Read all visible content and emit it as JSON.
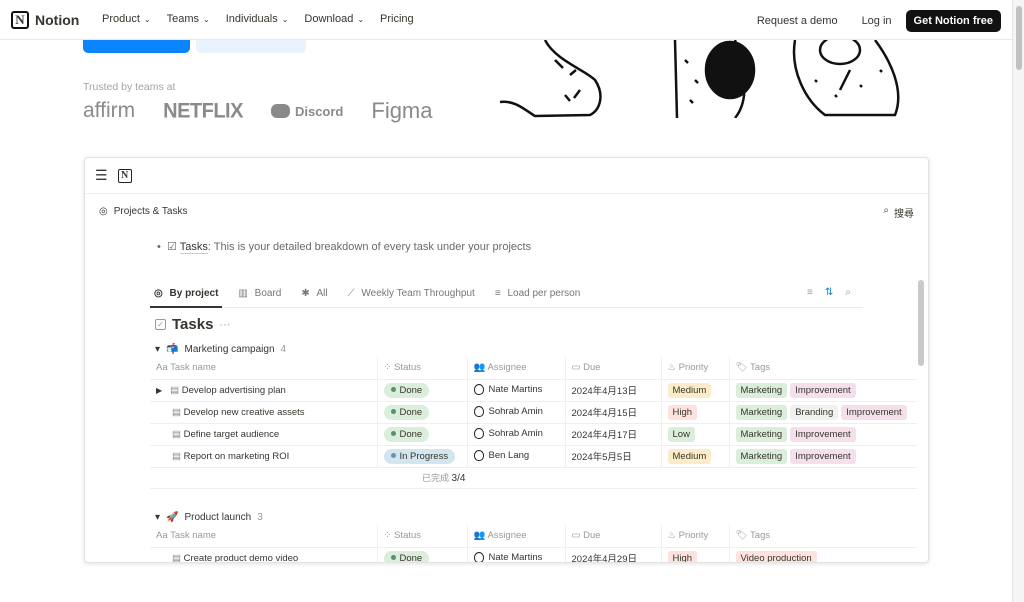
{
  "nav": {
    "brand": "Notion",
    "menu": [
      {
        "label": "Product"
      },
      {
        "label": "Teams"
      },
      {
        "label": "Individuals"
      },
      {
        "label": "Download"
      },
      {
        "label": "Pricing"
      }
    ],
    "request_demo": "Request a demo",
    "login": "Log in",
    "get_free": "Get Notion free"
  },
  "hero": {
    "trusted": "Trusted by teams at",
    "logos": [
      "affirm",
      "NETFLIX",
      "Discord",
      "Figma"
    ]
  },
  "app": {
    "breadcrumb": "Projects & Tasks",
    "search": "搜尋",
    "bullet": {
      "label": "Tasks",
      "text": ": This is your detailed breakdown of every task under your projects"
    },
    "tabs": [
      {
        "label": "By project",
        "icon": "target-icon"
      },
      {
        "label": "Board",
        "icon": "board-icon"
      },
      {
        "label": "All",
        "icon": "asterisk-icon"
      },
      {
        "label": "Weekly Team Throughput",
        "icon": "chart-icon"
      },
      {
        "label": "Load per person",
        "icon": "bars-icon"
      }
    ],
    "db_title": "Tasks",
    "columns": [
      "Task name",
      "Status",
      "Assignee",
      "Due",
      "Priority",
      "Tags"
    ],
    "groups": [
      {
        "name": "Marketing campaign",
        "emoji": "📬",
        "count": "4",
        "summary_label": "已完成",
        "summary_value": "3/4",
        "rows": [
          {
            "name": "Develop advertising plan",
            "status": "Done",
            "assignee": "Nate Martins",
            "due": "2024年4月13日",
            "priority": "Medium",
            "tags": [
              "Marketing",
              "Improvement"
            ]
          },
          {
            "name": "Develop new creative assets",
            "status": "Done",
            "assignee": "Sohrab Amin",
            "due": "2024年4月15日",
            "priority": "High",
            "tags": [
              "Marketing",
              "Branding",
              "Improvement"
            ]
          },
          {
            "name": "Define target audience",
            "status": "Done",
            "assignee": "Sohrab Amin",
            "due": "2024年4月17日",
            "priority": "Low",
            "tags": [
              "Marketing",
              "Improvement"
            ]
          },
          {
            "name": "Report on marketing ROI",
            "status": "In Progress",
            "assignee": "Ben Lang",
            "due": "2024年5月5日",
            "priority": "Medium",
            "tags": [
              "Marketing",
              "Improvement"
            ]
          }
        ]
      },
      {
        "name": "Product launch",
        "emoji": "🚀",
        "count": "3",
        "rows": [
          {
            "name": "Create product demo video",
            "status": "Done",
            "assignee": "Nate Martins",
            "due": "2024年4月29日",
            "priority": "High",
            "tags": [
              "Video production"
            ]
          }
        ]
      }
    ]
  },
  "colors": {
    "done": "#dbeddb",
    "in_progress": "#d3e5ef",
    "medium": "#fdecc8",
    "high": "#ffe2dd",
    "low": "#dbeddb",
    "marketing": "#dbeddb",
    "improvement": "#f4dfeb",
    "branding": "#f1f1ef",
    "video": "#ffe2dd",
    "accent": "#0a85ff"
  }
}
